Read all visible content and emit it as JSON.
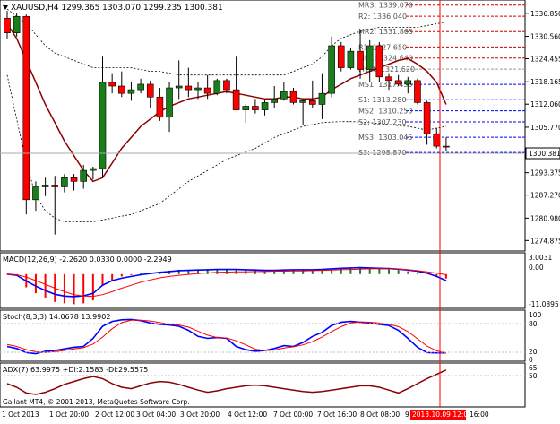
{
  "header": {
    "symbol_line": "XAUUSD,H4  1299.365 1303.070 1299.235 1300.381"
  },
  "price_axis": {
    "ticks": [
      "1336.850",
      "1330.560",
      "1324.455",
      "1318.165",
      "1312.060",
      "1305.770",
      "1300.381",
      "1293.375",
      "1287.270",
      "1280.980",
      "1274.875"
    ],
    "current": "1300.381"
  },
  "pivot_labels": [
    {
      "name": "MR3",
      "text": "MR3: 1339.070"
    },
    {
      "name": "R2",
      "text": "R2: 1336.040"
    },
    {
      "name": "MR2",
      "text": "MR2: 1331.865"
    },
    {
      "name": "R1",
      "text": "R1: 1327.650"
    },
    {
      "name": "MR1",
      "text": "MR1: 1324.640"
    },
    {
      "name": "Pivot",
      "text": "Pivot: 1321.620"
    },
    {
      "name": "MS1",
      "text": "MS1: 1317.455"
    },
    {
      "name": "S1",
      "text": "S1: 1313.280"
    },
    {
      "name": "MS2",
      "text": "MS2: 1310.250"
    },
    {
      "name": "S2",
      "text": "S2: 1307.230"
    },
    {
      "name": "MS3",
      "text": "MS3: 1303.045"
    },
    {
      "name": "S3",
      "text": "S3: 1298.870"
    }
  ],
  "macd": {
    "label": "MACD(12,26,9) -2.2620 0.0330 0.0000 -2.2949",
    "ticks": [
      "3.0031",
      "0.00",
      "-11.0895"
    ]
  },
  "stoch": {
    "label": "Stoch(8,3,3) 14.0678 13.9902",
    "ticks": [
      "100",
      "80",
      "20",
      "0"
    ]
  },
  "adx": {
    "label": "ADX(7) 63.9975 +DI:2.1583 -DI:29.5575",
    "ticks": [
      "65",
      "50"
    ],
    "copyright": "Gallant MT4, © 2001-2013, MetaQuotes Software Corp."
  },
  "time_axis": {
    "labels": [
      "1 Oct 2013",
      "1 Oct 20:00",
      "2 Oct 12:00",
      "3 Oct 04:00",
      "3 Oct 20:00",
      "4 Oct 12:00",
      "7 Oct 00:00",
      "7 Oct 16:00",
      "8 Oct 08:00",
      "9"
    ],
    "highlight": "2013.10.09 12:00",
    "after_highlight": "16:00"
  },
  "colors": {
    "bull": "#1a7f1a",
    "bear": "#ff0000",
    "ma": "#8b0000",
    "macd_main": "#0000ff",
    "signal": "#ff0000",
    "stoch_main": "#0000ff",
    "vline": "#ff0000",
    "pivot_res": "#cc0000",
    "pivot_sup": "#0000ff",
    "pivot_mid": "#999999",
    "highlight_bg": "#ff0000"
  },
  "candles": [
    [
      1335.5,
      1337.5,
      1330.0,
      1331.5
    ],
    [
      1331.5,
      1337.0,
      1330.5,
      1336.0
    ],
    [
      1336.0,
      1336.5,
      1282.0,
      1286.0
    ],
    [
      1286.0,
      1291.0,
      1283.0,
      1289.5
    ],
    [
      1289.5,
      1292.0,
      1287.0,
      1290.0
    ],
    [
      1290.0,
      1292.5,
      1276.5,
      1289.5
    ],
    [
      1289.5,
      1293.0,
      1288.0,
      1292.0
    ],
    [
      1292.0,
      1293.0,
      1288.5,
      1291.0
    ],
    [
      1291.0,
      1295.5,
      1289.0,
      1294.0
    ],
    [
      1294.0,
      1295.0,
      1291.5,
      1294.5
    ],
    [
      1294.5,
      1325.0,
      1292.0,
      1318.0
    ],
    [
      1318.0,
      1320.5,
      1315.0,
      1317.0
    ],
    [
      1317.0,
      1321.0,
      1314.0,
      1315.0
    ],
    [
      1315.0,
      1318.0,
      1313.0,
      1316.0
    ],
    [
      1316.0,
      1319.0,
      1315.0,
      1317.5
    ],
    [
      1317.5,
      1318.5,
      1311.0,
      1314.0
    ],
    [
      1314.0,
      1316.5,
      1307.5,
      1308.5
    ],
    [
      1308.5,
      1318.0,
      1304.5,
      1316.5
    ],
    [
      1316.5,
      1324.0,
      1313.5,
      1317.0
    ],
    [
      1317.0,
      1322.0,
      1314.0,
      1316.0
    ],
    [
      1316.0,
      1318.0,
      1313.5,
      1316.5
    ],
    [
      1316.5,
      1320.0,
      1313.5,
      1315.0
    ],
    [
      1315.0,
      1319.0,
      1314.5,
      1318.5
    ],
    [
      1318.5,
      1319.0,
      1315.0,
      1316.0
    ],
    [
      1316.0,
      1325.0,
      1312.0,
      1310.5
    ],
    [
      1310.5,
      1312.0,
      1307.0,
      1311.5
    ],
    [
      1311.5,
      1313.5,
      1309.5,
      1310.5
    ],
    [
      1310.5,
      1313.5,
      1309.0,
      1312.5
    ],
    [
      1312.5,
      1317.0,
      1311.0,
      1313.5
    ],
    [
      1313.5,
      1318.0,
      1313.0,
      1315.5
    ],
    [
      1315.5,
      1316.5,
      1312.0,
      1312.5
    ],
    [
      1312.5,
      1313.5,
      1306.5,
      1313.0
    ],
    [
      1313.0,
      1318.5,
      1311.0,
      1312.0
    ],
    [
      1312.0,
      1320.5,
      1308.0,
      1315.0
    ],
    [
      1315.0,
      1330.5,
      1314.0,
      1328.0
    ],
    [
      1328.0,
      1329.0,
      1321.0,
      1322.0
    ],
    [
      1322.0,
      1327.5,
      1321.5,
      1326.5
    ],
    [
      1326.5,
      1332.0,
      1319.0,
      1321.5
    ],
    [
      1321.5,
      1329.5,
      1318.0,
      1328.0
    ],
    [
      1328.0,
      1329.0,
      1318.0,
      1319.5
    ],
    [
      1319.5,
      1320.5,
      1316.0,
      1318.5
    ],
    [
      1318.5,
      1320.0,
      1317.0,
      1317.5
    ],
    [
      1317.5,
      1319.5,
      1315.0,
      1318.5
    ],
    [
      1318.5,
      1319.0,
      1312.0,
      1312.5
    ],
    [
      1312.5,
      1313.0,
      1301.0,
      1304.0
    ],
    [
      1304.0,
      1305.5,
      1300.0,
      1300.6
    ],
    [
      1300.6,
      1303.0,
      1299.2,
      1300.4
    ]
  ],
  "ma": [
    1334,
    1330,
    1324,
    1318,
    1312,
    1307,
    1302,
    1298,
    1294,
    1291,
    1292,
    1296,
    1300,
    1303,
    1306,
    1308,
    1310,
    1311.5,
    1312.5,
    1313.5,
    1314,
    1314.5,
    1315,
    1315.5,
    1315,
    1314.5,
    1314,
    1313.5,
    1313.5,
    1314,
    1314,
    1313.5,
    1313.5,
    1314,
    1316,
    1317.5,
    1319,
    1320,
    1321,
    1322,
    1323,
    1324,
    1324.5,
    1323,
    1321,
    1318,
    1312
  ],
  "bb_upper": [
    1338,
    1336,
    1334,
    1331,
    1328,
    1326,
    1325,
    1324,
    1323,
    1322,
    1322,
    1322,
    1322,
    1322,
    1321.5,
    1321,
    1321,
    1320.5,
    1320,
    1320,
    1320,
    1320,
    1320,
    1320,
    1320,
    1320,
    1320,
    1320,
    1320,
    1320,
    1321,
    1322,
    1323,
    1325,
    1328,
    1330,
    1331,
    1332,
    1332.5,
    1333,
    1333,
    1333,
    1333,
    1333,
    1333.5,
    1334,
    1334.5
  ],
  "bb_lower": [
    1320,
    1308,
    1296,
    1287,
    1283,
    1281,
    1280,
    1280,
    1280,
    1280,
    1280.5,
    1281,
    1281.5,
    1282,
    1283,
    1284,
    1285,
    1287,
    1289,
    1291,
    1292.5,
    1294,
    1295.5,
    1297,
    1298,
    1299,
    1300,
    1301.5,
    1303,
    1304,
    1305,
    1306,
    1306.5,
    1307,
    1307.2,
    1307.3,
    1307.3,
    1307.2,
    1307,
    1306.8,
    1306.5,
    1306.2,
    1306,
    1305.5,
    1305,
    1305.5,
    1306
  ],
  "macd_hist": [
    -0.2,
    -0.5,
    -4.5,
    -6.5,
    -8,
    -9.5,
    -10,
    -10.3,
    -10,
    -9,
    -4,
    -2,
    -0.8,
    -0.3,
    0.3,
    0.5,
    0.8,
    1.2,
    1.5,
    1.5,
    1.6,
    1.7,
    1.7,
    1.8,
    1.7,
    1.5,
    1.4,
    1.3,
    1.3,
    1.4,
    1.5,
    1.5,
    1.4,
    1.5,
    1.8,
    2.0,
    2.0,
    2.1,
    1.9,
    1.8,
    1.6,
    1.4,
    1.0,
    0.6,
    0,
    -0.8,
    -1.5
  ],
  "macd_signal": [
    0,
    -0.2,
    -1.0,
    -2.2,
    -3.5,
    -4.8,
    -6.0,
    -7.0,
    -7.5,
    -7.6,
    -7.0,
    -6.0,
    -4.8,
    -3.8,
    -2.8,
    -2.0,
    -1.3,
    -0.8,
    -0.4,
    -0.1,
    0.2,
    0.4,
    0.6,
    0.7,
    0.8,
    0.8,
    0.9,
    0.9,
    1.0,
    1.0,
    1.1,
    1.1,
    1.2,
    1.3,
    1.4,
    1.5,
    1.6,
    1.7,
    1.8,
    1.8,
    1.8,
    1.7,
    1.5,
    1.2,
    0.8,
    0.3,
    -0.2
  ],
  "macd_main": [
    0,
    -0.4,
    -2.4,
    -4.1,
    -5.6,
    -6.9,
    -7.5,
    -7.7,
    -7.4,
    -6.6,
    -3.8,
    -2.2,
    -1.4,
    -0.8,
    -0.2,
    0.2,
    0.6,
    0.9,
    1.2,
    1.3,
    1.4,
    1.5,
    1.6,
    1.6,
    1.6,
    1.5,
    1.4,
    1.3,
    1.3,
    1.4,
    1.5,
    1.5,
    1.5,
    1.6,
    1.8,
    2.0,
    2.1,
    2.2,
    2.1,
    2.0,
    1.9,
    1.7,
    1.4,
    1.0,
    0.3,
    -0.8,
    -2.2
  ],
  "stoch_main": [
    30,
    25,
    15,
    12,
    18,
    20,
    24,
    28,
    30,
    50,
    80,
    92,
    96,
    97,
    94,
    88,
    85,
    83,
    80,
    70,
    55,
    50,
    52,
    50,
    30,
    22,
    18,
    20,
    25,
    32,
    30,
    40,
    55,
    65,
    82,
    90,
    92,
    90,
    88,
    85,
    82,
    70,
    50,
    28,
    15,
    14,
    14
  ],
  "stoch_signal": [
    35,
    30,
    22,
    17,
    15,
    17,
    20,
    24,
    27,
    36,
    53,
    74,
    89,
    95,
    95,
    93,
    89,
    85,
    83,
    78,
    68,
    58,
    52,
    51,
    44,
    34,
    23,
    20,
    21,
    26,
    29,
    34,
    42,
    53,
    67,
    79,
    88,
    91,
    90,
    88,
    85,
    79,
    67,
    49,
    31,
    19,
    14
  ],
  "adx_line": [
    45,
    40,
    32,
    30,
    33,
    38,
    44,
    48,
    52,
    55,
    52,
    45,
    40,
    38,
    42,
    46,
    48,
    47,
    44,
    40,
    36,
    33,
    35,
    38,
    40,
    42,
    43,
    42,
    40,
    38,
    36,
    34,
    33,
    34,
    36,
    38,
    40,
    42,
    42,
    40,
    36,
    32,
    38,
    45,
    52,
    58,
    64
  ]
}
